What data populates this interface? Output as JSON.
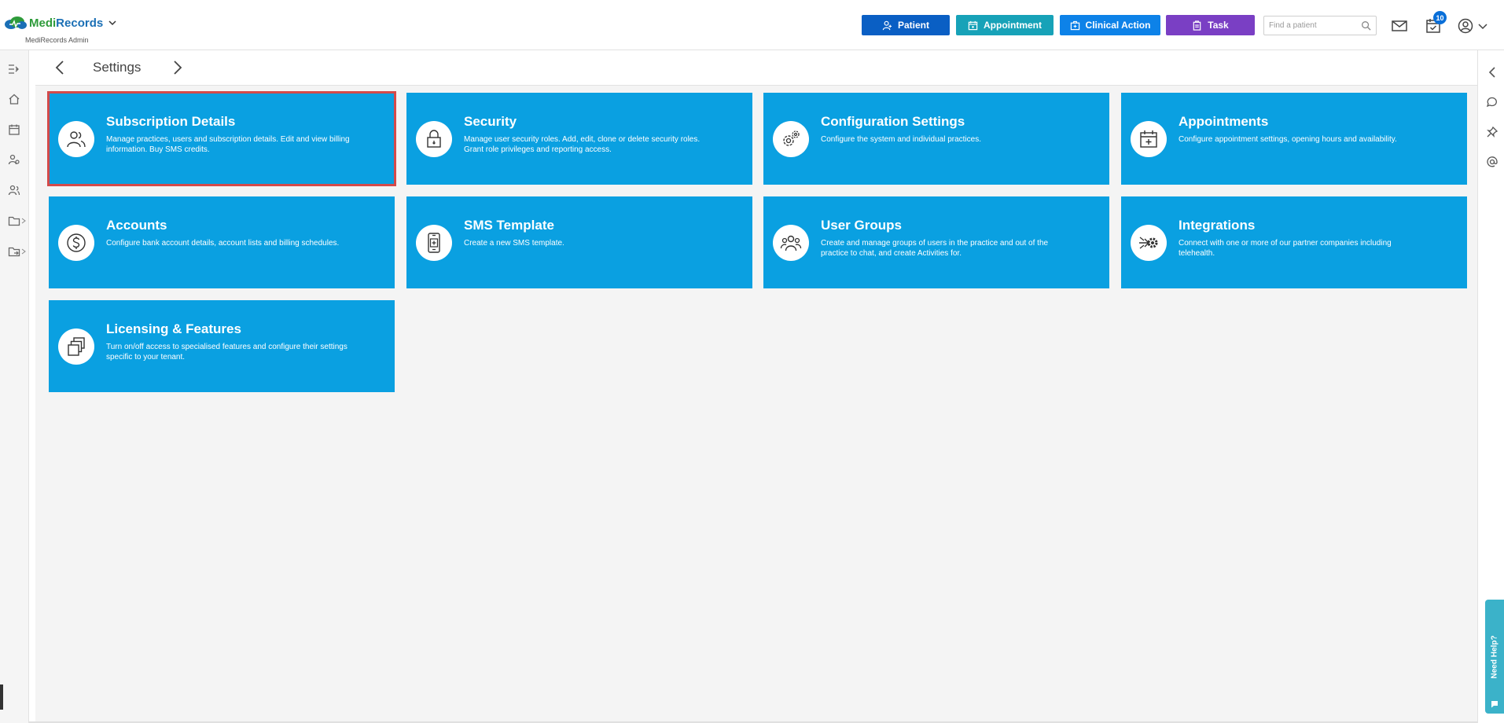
{
  "app": {
    "brand_part1": "Medi",
    "brand_part2": "Records",
    "subtitle": "MediRecords Admin"
  },
  "header": {
    "buttons": {
      "patient": "Patient",
      "appointment": "Appointment",
      "clinical_action": "Clinical Action",
      "task": "Task"
    },
    "search_placeholder": "Find a patient",
    "task_badge": "10"
  },
  "page": {
    "title": "Settings"
  },
  "cards": [
    {
      "title": "Subscription Details",
      "description": "Manage practices, users and subscription details. Edit and view billing information. Buy SMS credits.",
      "icon": "users-icon",
      "selected": true
    },
    {
      "title": "Security",
      "description": "Manage user security roles. Add, edit, clone or delete security roles. Grant role privileges and reporting access.",
      "icon": "lock-icon"
    },
    {
      "title": "Configuration Settings",
      "description": "Configure the system and individual practices.",
      "icon": "gears-icon"
    },
    {
      "title": "Appointments",
      "description": "Configure appointment settings, opening hours and availability.",
      "icon": "calendar-plus-icon"
    },
    {
      "title": "Accounts",
      "description": "Configure bank account details, account lists and billing schedules.",
      "icon": "dollar-icon"
    },
    {
      "title": "SMS Template",
      "description": "Create a new SMS template.",
      "icon": "phone-template-icon"
    },
    {
      "title": "User Groups",
      "description": "Create and manage groups of users in the practice and out of the practice to chat, and create Activities for.",
      "icon": "user-group-icon"
    },
    {
      "title": "Integrations",
      "description": "Connect with one or more of our partner companies including telehealth.",
      "icon": "integration-icon"
    },
    {
      "title": "Licensing & Features",
      "description": "Turn on/off access to specialised features and configure their settings specific to your tenant.",
      "icon": "layers-icon"
    }
  ],
  "help": {
    "label": "Need Help?"
  },
  "colors": {
    "card": "#0aa0e1",
    "selected_outline": "#d34a4a",
    "patient_btn": "#0a5fc4",
    "appointment_btn": "#17a2b8",
    "clinical_btn": "#0d82e8",
    "task_btn": "#7a3fc4"
  }
}
